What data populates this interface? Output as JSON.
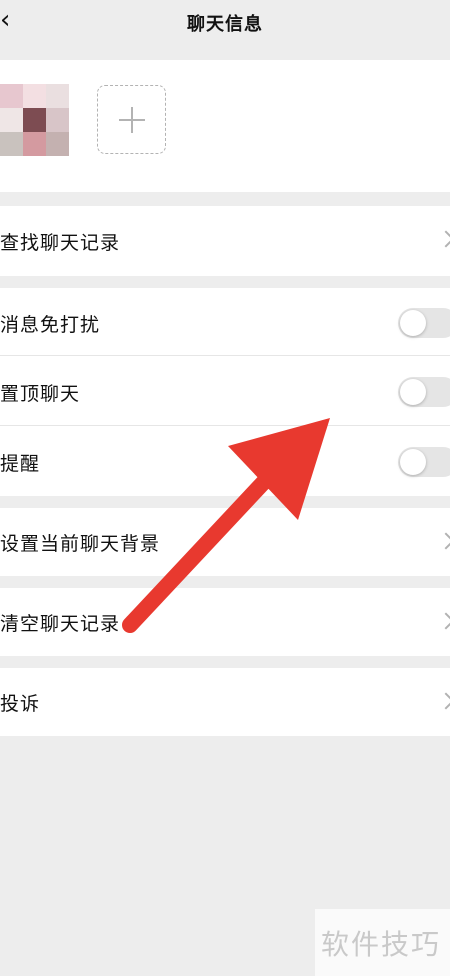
{
  "header": {
    "title": "聊天信息"
  },
  "members": {
    "add_icon": "plus-icon"
  },
  "search_history": {
    "label": "查找聊天记录"
  },
  "settings": [
    {
      "label": "消息免打扰",
      "on": false
    },
    {
      "label": "置顶聊天",
      "on": false
    },
    {
      "label": "提醒",
      "on": false
    }
  ],
  "background": {
    "label": "设置当前聊天背景"
  },
  "clear_history": {
    "label": "清空聊天记录"
  },
  "complain": {
    "label": "投诉"
  },
  "overlay": {
    "annotation": "red-arrow",
    "color": "#e8392f"
  },
  "watermark": {
    "text": "软件技巧"
  }
}
